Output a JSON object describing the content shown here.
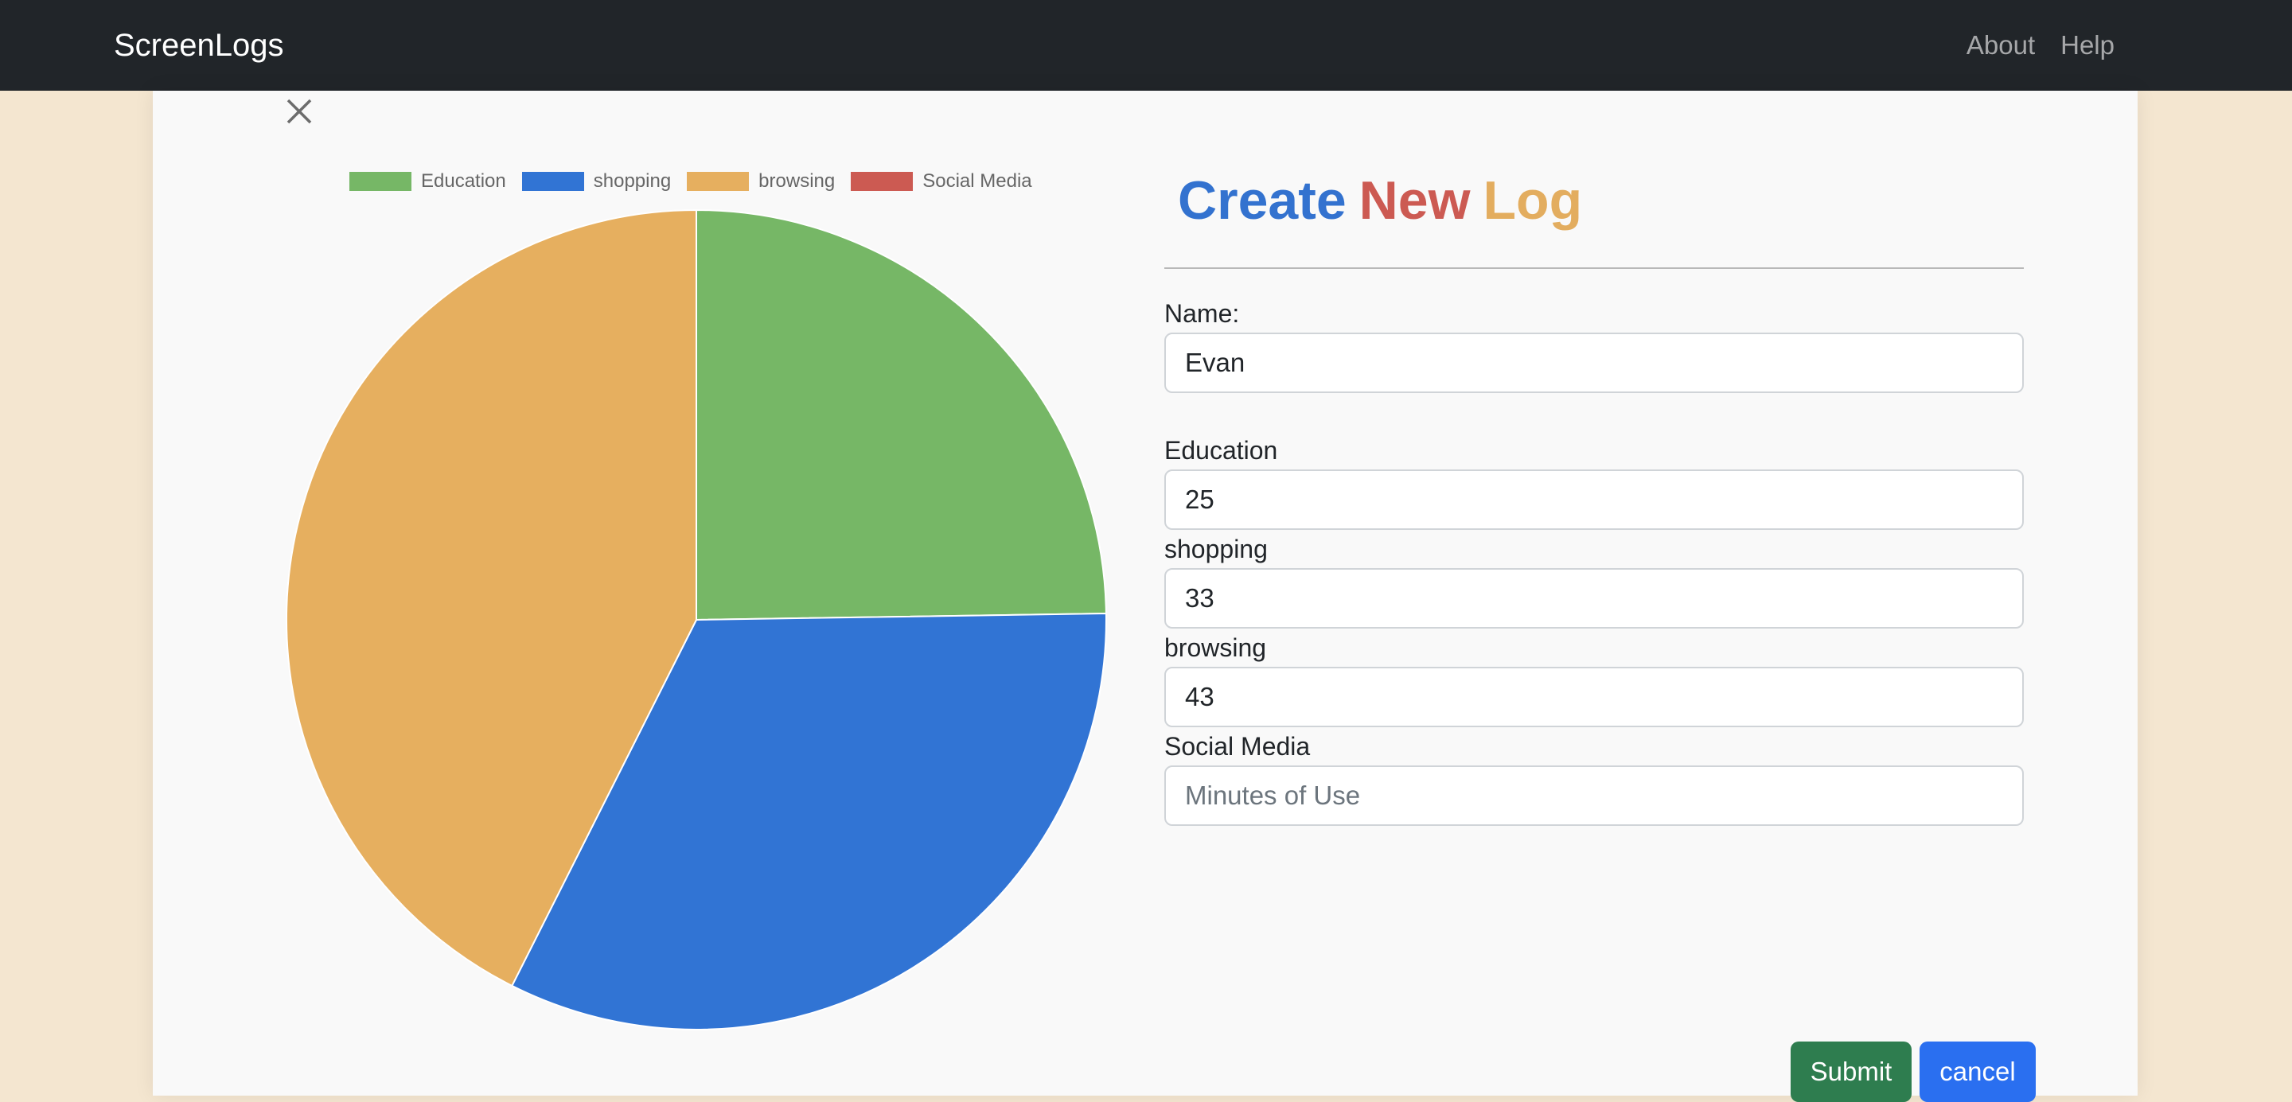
{
  "navbar": {
    "brand": "ScreenLogs",
    "links": [
      "About",
      "Help"
    ]
  },
  "modal": {
    "close_icon": "close-icon",
    "title": {
      "words": [
        {
          "text": "Create",
          "color": "#3372cf"
        },
        {
          "text": "New",
          "color": "#cc5a52"
        },
        {
          "text": "Log",
          "color": "#e3ad5f"
        }
      ]
    },
    "form": {
      "name_label": "Name:",
      "name_value": "Evan",
      "fields": [
        {
          "label": "Education",
          "value": "25",
          "placeholder": "Minutes of Use"
        },
        {
          "label": "shopping",
          "value": "33",
          "placeholder": "Minutes of Use"
        },
        {
          "label": "browsing",
          "value": "43",
          "placeholder": "Minutes of Use"
        },
        {
          "label": "Social Media",
          "value": "",
          "placeholder": "Minutes of Use"
        }
      ]
    },
    "buttons": {
      "submit_label": "Submit",
      "cancel_label": "cancel"
    }
  },
  "chart_data": {
    "type": "pie",
    "categories": [
      "Education",
      "shopping",
      "browsing",
      "Social Media"
    ],
    "values": [
      25,
      33,
      43,
      0
    ],
    "colors": [
      "#76b766",
      "#3174d4",
      "#e6af5f",
      "#cc5a52"
    ],
    "legend_position": "top"
  }
}
